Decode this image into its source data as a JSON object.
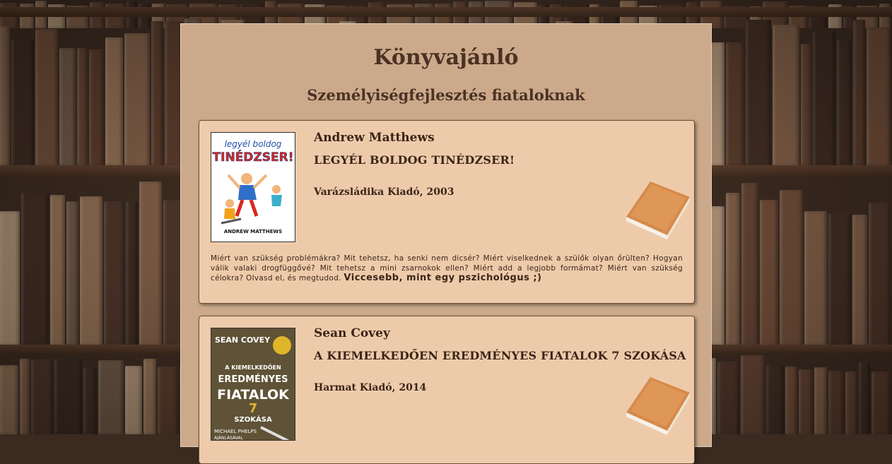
{
  "header": {
    "title": "Könyvajánló",
    "subtitle": "Személyiségfejlesztés fiataloknak"
  },
  "books": [
    {
      "author": "Andrew Matthews",
      "title": "LEGYÉL BOLDOG TINÉDZSER!",
      "publisher": "Varázsládika Kiadó, 2003",
      "cover_top": "legyél boldog",
      "cover_main": "TINÉDZSER!",
      "cover_author": "ANDREW MATTHEWS",
      "description": "Miért van szükség problémákra? Mit tehetsz, ha senki nem dicsér? Miért viselkednek a szülők olyan őrülten? Hogyan válik valaki drogfüggővé? Mit tehetsz a mini zsarnokok ellen? Miért add a legjobb formámat? Miért van szükség célokra? Olvasd el, és megtudod.",
      "highlight": "Viccesebb, mint egy pszichológus ;)"
    },
    {
      "author": "Sean Covey",
      "title": "A KIEMELKEDŐEN EREDMÉNYES FIATALOK 7 SZOKÁSA",
      "publisher": "Harmat Kiadó, 2014",
      "cover_author": "SEAN COVEY",
      "cover_line1": "A KIEMELKEDŐEN",
      "cover_line2": "EREDMÉNYES",
      "cover_line3": "FIATALOK",
      "cover_num": "7",
      "cover_line4": "SZOKÁSA",
      "cover_line5": "MICHAEL PHELPS",
      "cover_line6": "AJÁNLÁSÁVAL"
    }
  ],
  "colors": {
    "page_bg": "#cba98a",
    "card_bg": "#edcbaa",
    "text": "#3b2418"
  },
  "icons": [
    "book-icon"
  ]
}
